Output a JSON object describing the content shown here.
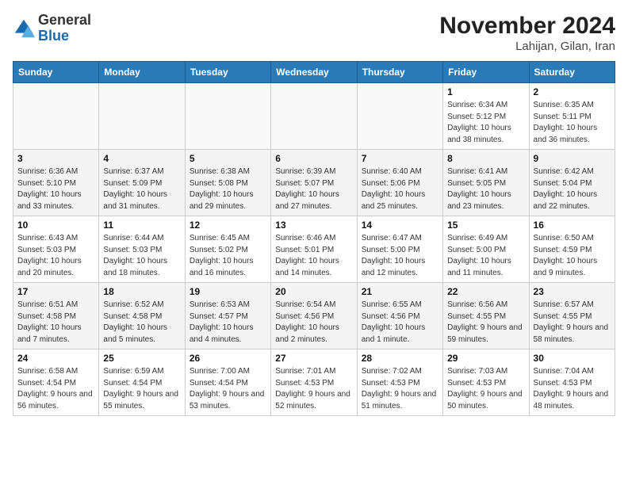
{
  "header": {
    "logo_general": "General",
    "logo_blue": "Blue",
    "title": "November 2024",
    "location": "Lahijan, Gilan, Iran"
  },
  "columns": [
    "Sunday",
    "Monday",
    "Tuesday",
    "Wednesday",
    "Thursday",
    "Friday",
    "Saturday"
  ],
  "weeks": [
    [
      {
        "day": "",
        "empty": true
      },
      {
        "day": "",
        "empty": true
      },
      {
        "day": "",
        "empty": true
      },
      {
        "day": "",
        "empty": true
      },
      {
        "day": "",
        "empty": true
      },
      {
        "day": "1",
        "sunrise": "Sunrise: 6:34 AM",
        "sunset": "Sunset: 5:12 PM",
        "daylight": "Daylight: 10 hours and 38 minutes."
      },
      {
        "day": "2",
        "sunrise": "Sunrise: 6:35 AM",
        "sunset": "Sunset: 5:11 PM",
        "daylight": "Daylight: 10 hours and 36 minutes."
      }
    ],
    [
      {
        "day": "3",
        "sunrise": "Sunrise: 6:36 AM",
        "sunset": "Sunset: 5:10 PM",
        "daylight": "Daylight: 10 hours and 33 minutes."
      },
      {
        "day": "4",
        "sunrise": "Sunrise: 6:37 AM",
        "sunset": "Sunset: 5:09 PM",
        "daylight": "Daylight: 10 hours and 31 minutes."
      },
      {
        "day": "5",
        "sunrise": "Sunrise: 6:38 AM",
        "sunset": "Sunset: 5:08 PM",
        "daylight": "Daylight: 10 hours and 29 minutes."
      },
      {
        "day": "6",
        "sunrise": "Sunrise: 6:39 AM",
        "sunset": "Sunset: 5:07 PM",
        "daylight": "Daylight: 10 hours and 27 minutes."
      },
      {
        "day": "7",
        "sunrise": "Sunrise: 6:40 AM",
        "sunset": "Sunset: 5:06 PM",
        "daylight": "Daylight: 10 hours and 25 minutes."
      },
      {
        "day": "8",
        "sunrise": "Sunrise: 6:41 AM",
        "sunset": "Sunset: 5:05 PM",
        "daylight": "Daylight: 10 hours and 23 minutes."
      },
      {
        "day": "9",
        "sunrise": "Sunrise: 6:42 AM",
        "sunset": "Sunset: 5:04 PM",
        "daylight": "Daylight: 10 hours and 22 minutes."
      }
    ],
    [
      {
        "day": "10",
        "sunrise": "Sunrise: 6:43 AM",
        "sunset": "Sunset: 5:03 PM",
        "daylight": "Daylight: 10 hours and 20 minutes."
      },
      {
        "day": "11",
        "sunrise": "Sunrise: 6:44 AM",
        "sunset": "Sunset: 5:03 PM",
        "daylight": "Daylight: 10 hours and 18 minutes."
      },
      {
        "day": "12",
        "sunrise": "Sunrise: 6:45 AM",
        "sunset": "Sunset: 5:02 PM",
        "daylight": "Daylight: 10 hours and 16 minutes."
      },
      {
        "day": "13",
        "sunrise": "Sunrise: 6:46 AM",
        "sunset": "Sunset: 5:01 PM",
        "daylight": "Daylight: 10 hours and 14 minutes."
      },
      {
        "day": "14",
        "sunrise": "Sunrise: 6:47 AM",
        "sunset": "Sunset: 5:00 PM",
        "daylight": "Daylight: 10 hours and 12 minutes."
      },
      {
        "day": "15",
        "sunrise": "Sunrise: 6:49 AM",
        "sunset": "Sunset: 5:00 PM",
        "daylight": "Daylight: 10 hours and 11 minutes."
      },
      {
        "day": "16",
        "sunrise": "Sunrise: 6:50 AM",
        "sunset": "Sunset: 4:59 PM",
        "daylight": "Daylight: 10 hours and 9 minutes."
      }
    ],
    [
      {
        "day": "17",
        "sunrise": "Sunrise: 6:51 AM",
        "sunset": "Sunset: 4:58 PM",
        "daylight": "Daylight: 10 hours and 7 minutes."
      },
      {
        "day": "18",
        "sunrise": "Sunrise: 6:52 AM",
        "sunset": "Sunset: 4:58 PM",
        "daylight": "Daylight: 10 hours and 5 minutes."
      },
      {
        "day": "19",
        "sunrise": "Sunrise: 6:53 AM",
        "sunset": "Sunset: 4:57 PM",
        "daylight": "Daylight: 10 hours and 4 minutes."
      },
      {
        "day": "20",
        "sunrise": "Sunrise: 6:54 AM",
        "sunset": "Sunset: 4:56 PM",
        "daylight": "Daylight: 10 hours and 2 minutes."
      },
      {
        "day": "21",
        "sunrise": "Sunrise: 6:55 AM",
        "sunset": "Sunset: 4:56 PM",
        "daylight": "Daylight: 10 hours and 1 minute."
      },
      {
        "day": "22",
        "sunrise": "Sunrise: 6:56 AM",
        "sunset": "Sunset: 4:55 PM",
        "daylight": "Daylight: 9 hours and 59 minutes."
      },
      {
        "day": "23",
        "sunrise": "Sunrise: 6:57 AM",
        "sunset": "Sunset: 4:55 PM",
        "daylight": "Daylight: 9 hours and 58 minutes."
      }
    ],
    [
      {
        "day": "24",
        "sunrise": "Sunrise: 6:58 AM",
        "sunset": "Sunset: 4:54 PM",
        "daylight": "Daylight: 9 hours and 56 minutes."
      },
      {
        "day": "25",
        "sunrise": "Sunrise: 6:59 AM",
        "sunset": "Sunset: 4:54 PM",
        "daylight": "Daylight: 9 hours and 55 minutes."
      },
      {
        "day": "26",
        "sunrise": "Sunrise: 7:00 AM",
        "sunset": "Sunset: 4:54 PM",
        "daylight": "Daylight: 9 hours and 53 minutes."
      },
      {
        "day": "27",
        "sunrise": "Sunrise: 7:01 AM",
        "sunset": "Sunset: 4:53 PM",
        "daylight": "Daylight: 9 hours and 52 minutes."
      },
      {
        "day": "28",
        "sunrise": "Sunrise: 7:02 AM",
        "sunset": "Sunset: 4:53 PM",
        "daylight": "Daylight: 9 hours and 51 minutes."
      },
      {
        "day": "29",
        "sunrise": "Sunrise: 7:03 AM",
        "sunset": "Sunset: 4:53 PM",
        "daylight": "Daylight: 9 hours and 50 minutes."
      },
      {
        "day": "30",
        "sunrise": "Sunrise: 7:04 AM",
        "sunset": "Sunset: 4:53 PM",
        "daylight": "Daylight: 9 hours and 48 minutes."
      }
    ]
  ]
}
